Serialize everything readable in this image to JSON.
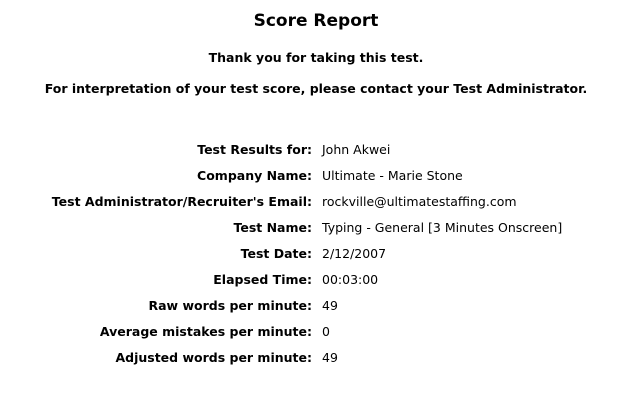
{
  "report": {
    "title": "Score Report",
    "thanks": "Thank you for taking this test.",
    "interpretation": "For interpretation of your test score, please contact your Test Administrator."
  },
  "results": [
    {
      "label": "Test Results for:",
      "value": "John Akwei"
    },
    {
      "label": "Company Name:",
      "value": "Ultimate - Marie Stone"
    },
    {
      "label": "Test Administrator/Recruiter's Email:",
      "value": "rockville@ultimatestaffing.com"
    },
    {
      "label": "Test Name:",
      "value": "Typing - General [3 Minutes Onscreen]"
    },
    {
      "label": "Test Date:",
      "value": "2/12/2007"
    },
    {
      "label": "Elapsed Time:",
      "value": "00:03:00"
    },
    {
      "label": "Raw words per minute:",
      "value": "49"
    },
    {
      "label": "Average mistakes per minute:",
      "value": "0"
    },
    {
      "label": "Adjusted words per minute:",
      "value": "49"
    }
  ]
}
